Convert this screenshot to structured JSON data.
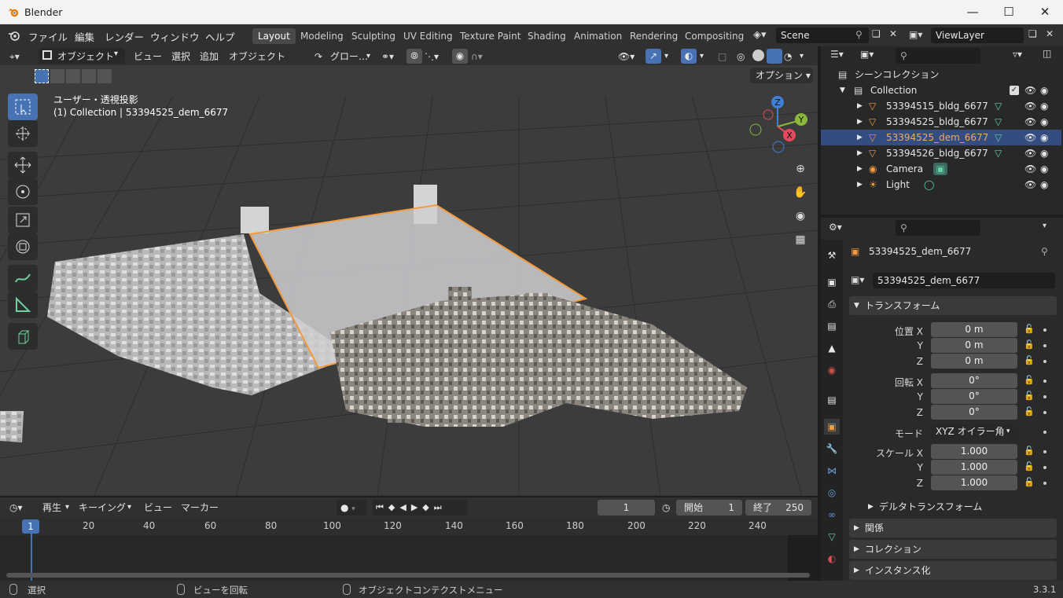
{
  "window": {
    "title": "Blender"
  },
  "menus": [
    "ファイル",
    "編集",
    "レンダー",
    "ウィンドウ",
    "ヘルプ"
  ],
  "workspaces": [
    "Layout",
    "Modeling",
    "Sculpting",
    "UV Editing",
    "Texture Paint",
    "Shading",
    "Animation",
    "Rendering",
    "Compositing"
  ],
  "scene": "Scene",
  "viewlayer": "ViewLayer",
  "viewport_header": {
    "mode": "オブジェクト",
    "view": "ビュー",
    "select": "選択",
    "add": "追加",
    "object": "オブジェクト",
    "orientation": "グロー…",
    "options": "オプション"
  },
  "viewport": {
    "projection": "ユーザー・透視投影",
    "context": "(1) Collection | 53394525_dem_6677"
  },
  "gizmo": {
    "z": "Z",
    "y": "Y",
    "x": "X"
  },
  "outliner": {
    "root": "シーンコレクション",
    "collection": "Collection",
    "items": [
      "53394515_bldg_6677",
      "53394525_bldg_6677",
      "53394525_dem_6677",
      "53394526_bldg_6677",
      "Camera",
      "Light"
    ]
  },
  "properties": {
    "object_name": "53394525_dem_6677",
    "mesh_name": "53394525_dem_6677",
    "transform_title": "トランスフォーム",
    "loc_label": "位置 X",
    "rot_label": "回転 X",
    "mode_label": "モード",
    "scale_label": "スケール X",
    "y": "Y",
    "z": "Z",
    "loc": [
      "0 m",
      "0 m",
      "0 m"
    ],
    "rot": [
      "0°",
      "0°",
      "0°"
    ],
    "mode": "XYZ オイラー角",
    "scale": [
      "1.000",
      "1.000",
      "1.000"
    ],
    "delta": "デルタトランスフォーム",
    "relations": "関係",
    "collections": "コレクション",
    "instancing": "インスタンス化"
  },
  "timeline": {
    "play": "再生",
    "keying": "キーイング",
    "view": "ビュー",
    "marker": "マーカー",
    "current": "1",
    "start_label": "開始",
    "start": "1",
    "end_label": "終了",
    "end": "250",
    "ticks": [
      "1",
      "20",
      "40",
      "60",
      "80",
      "100",
      "120",
      "140",
      "160",
      "180",
      "200",
      "220",
      "240"
    ]
  },
  "status": {
    "select": "選択",
    "rotate": "ビューを回転",
    "context_menu": "オブジェクトコンテクストメニュー",
    "version": "3.3.1"
  },
  "colors": {
    "accent": "#4772b3",
    "selection": "#f39b3c",
    "header": "#303030"
  }
}
